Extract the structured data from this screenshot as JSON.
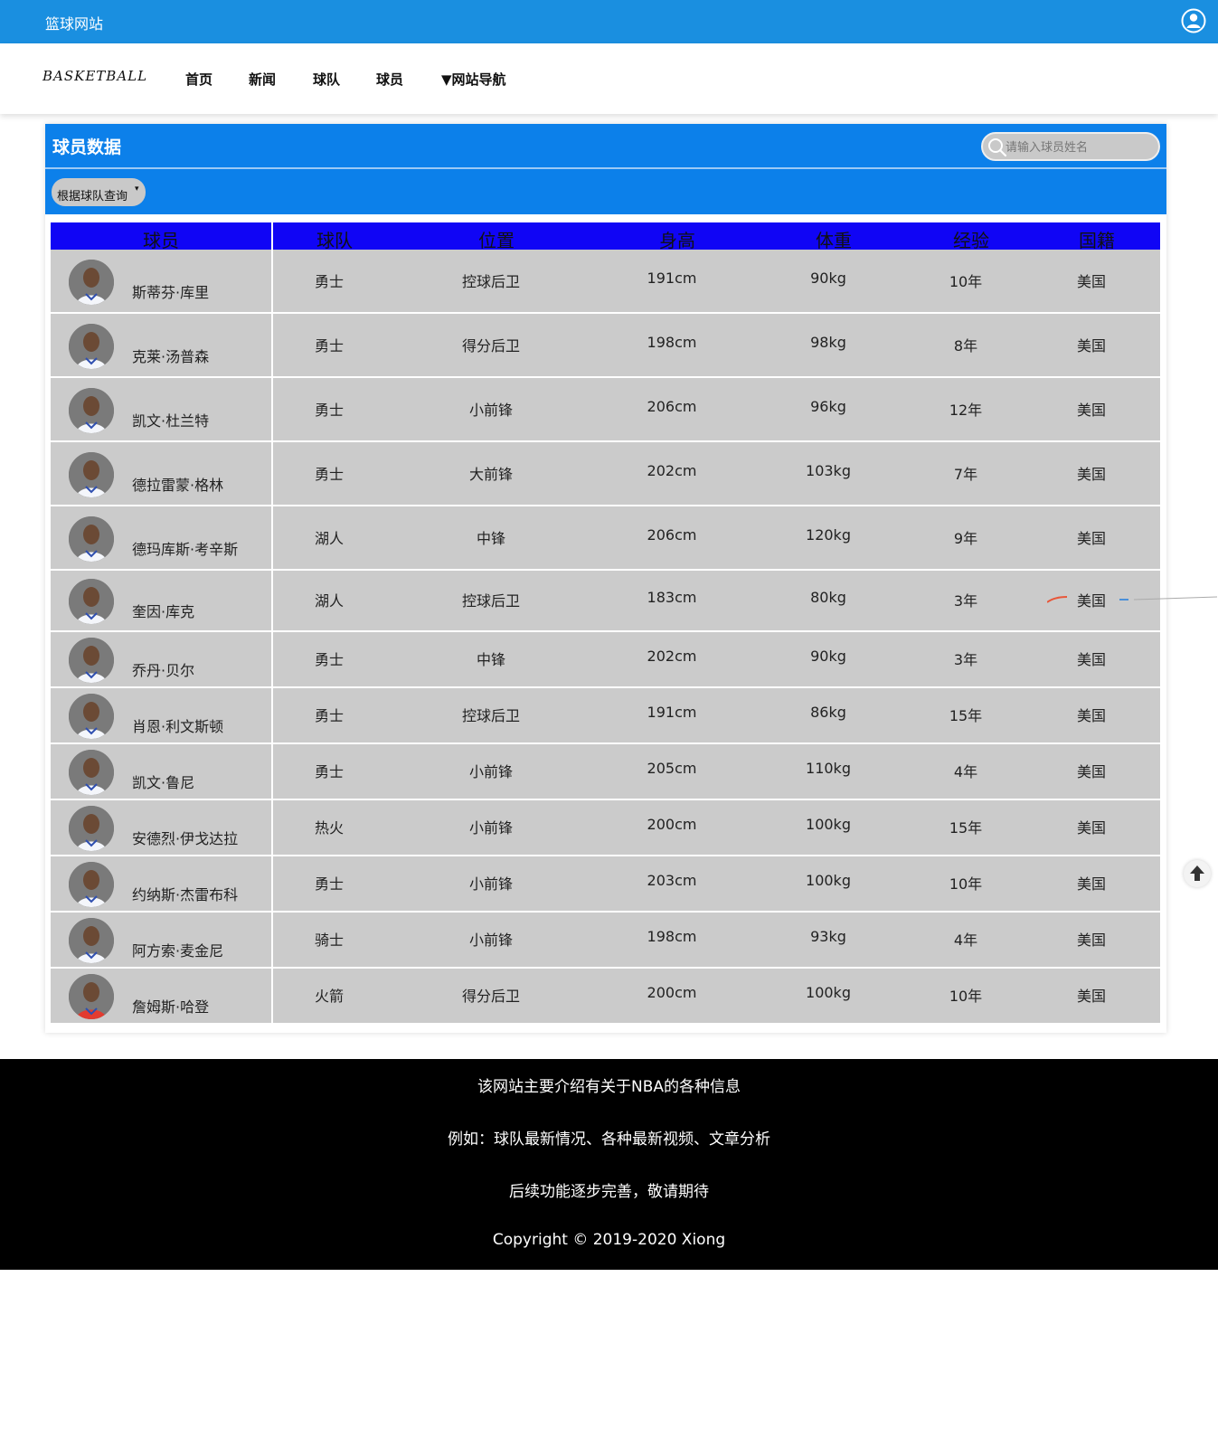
{
  "topbar": {
    "site_title": "篮球网站",
    "user_icon": "user-circle-icon"
  },
  "navbar": {
    "logo": "BASKETBALL",
    "items": [
      {
        "label": "首页"
      },
      {
        "label": "新闻"
      },
      {
        "label": "球队"
      },
      {
        "label": "球员"
      },
      {
        "label": "▼网站导航"
      }
    ]
  },
  "panel": {
    "title": "球员数据",
    "search_placeholder": "请输入球员姓名",
    "search_icon": "search-icon",
    "team_filter_label": "根据球队查询",
    "team_filter_caret": "▾"
  },
  "table": {
    "headers": [
      "球员",
      "球队",
      "位置",
      "身高",
      "体重",
      "经验",
      "国籍"
    ],
    "rows": [
      {
        "name": "斯蒂芬·库里",
        "team": "勇士",
        "position": "控球后卫",
        "height": "191cm",
        "weight": "90kg",
        "experience": "10年",
        "nationality": "美国",
        "jersey": "#f4f6fb"
      },
      {
        "name": "克莱·汤普森",
        "team": "勇士",
        "position": "得分后卫",
        "height": "198cm",
        "weight": "98kg",
        "experience": "8年",
        "nationality": "美国",
        "jersey": "#f4f6fb"
      },
      {
        "name": "凯文·杜兰特",
        "team": "勇士",
        "position": "小前锋",
        "height": "206cm",
        "weight": "96kg",
        "experience": "12年",
        "nationality": "美国",
        "jersey": "#f4f6fb"
      },
      {
        "name": "德拉雷蒙·格林",
        "team": "勇士",
        "position": "大前锋",
        "height": "202cm",
        "weight": "103kg",
        "experience": "7年",
        "nationality": "美国",
        "jersey": "#f4f6fb"
      },
      {
        "name": "德玛库斯·考辛斯",
        "team": "湖人",
        "position": "中锋",
        "height": "206cm",
        "weight": "120kg",
        "experience": "9年",
        "nationality": "美国",
        "jersey": "#f4f6fb"
      },
      {
        "name": "奎因·库克",
        "team": "湖人",
        "position": "控球后卫",
        "height": "183cm",
        "weight": "80kg",
        "experience": "3年",
        "nationality": "美国",
        "jersey": "#f4f6fb"
      },
      {
        "name": "乔丹·贝尔",
        "team": "勇士",
        "position": "中锋",
        "height": "202cm",
        "weight": "90kg",
        "experience": "3年",
        "nationality": "美国",
        "jersey": "#f4f6fb"
      },
      {
        "name": "肖恩·利文斯顿",
        "team": "勇士",
        "position": "控球后卫",
        "height": "191cm",
        "weight": "86kg",
        "experience": "15年",
        "nationality": "美国",
        "jersey": "#f4f6fb"
      },
      {
        "name": "凯文·鲁尼",
        "team": "勇士",
        "position": "小前锋",
        "height": "205cm",
        "weight": "110kg",
        "experience": "4年",
        "nationality": "美国",
        "jersey": "#f4f6fb"
      },
      {
        "name": "安德烈·伊戈达拉",
        "team": "热火",
        "position": "小前锋",
        "height": "200cm",
        "weight": "100kg",
        "experience": "15年",
        "nationality": "美国",
        "jersey": "#f4f6fb"
      },
      {
        "name": "约纳斯·杰雷布科",
        "team": "勇士",
        "position": "小前锋",
        "height": "203cm",
        "weight": "100kg",
        "experience": "10年",
        "nationality": "美国",
        "jersey": "#f4f6fb"
      },
      {
        "name": "阿方索·麦金尼",
        "team": "骑士",
        "position": "小前锋",
        "height": "198cm",
        "weight": "93kg",
        "experience": "4年",
        "nationality": "美国",
        "jersey": "#f4f6fb"
      },
      {
        "name": "詹姆斯·哈登",
        "team": "火箭",
        "position": "得分后卫",
        "height": "200cm",
        "weight": "100kg",
        "experience": "10年",
        "nationality": "美国",
        "jersey": "#e23b30"
      }
    ]
  },
  "scroll_top_icon": "arrow-up-icon",
  "footer": {
    "lines": [
      "该网站主要介绍有关于NBA的各种信息",
      "例如：球队最新情况、各种最新视频、文章分析",
      "后续功能逐步完善，敬请期待",
      "Copyright © 2019-2020 Xiong"
    ]
  },
  "colors": {
    "topbar": "#1a8fe0",
    "panel_header": "#0c80ea",
    "table_header": "#1005f5",
    "row_bg": "#cbcbcb",
    "footer_bg": "#000000"
  }
}
